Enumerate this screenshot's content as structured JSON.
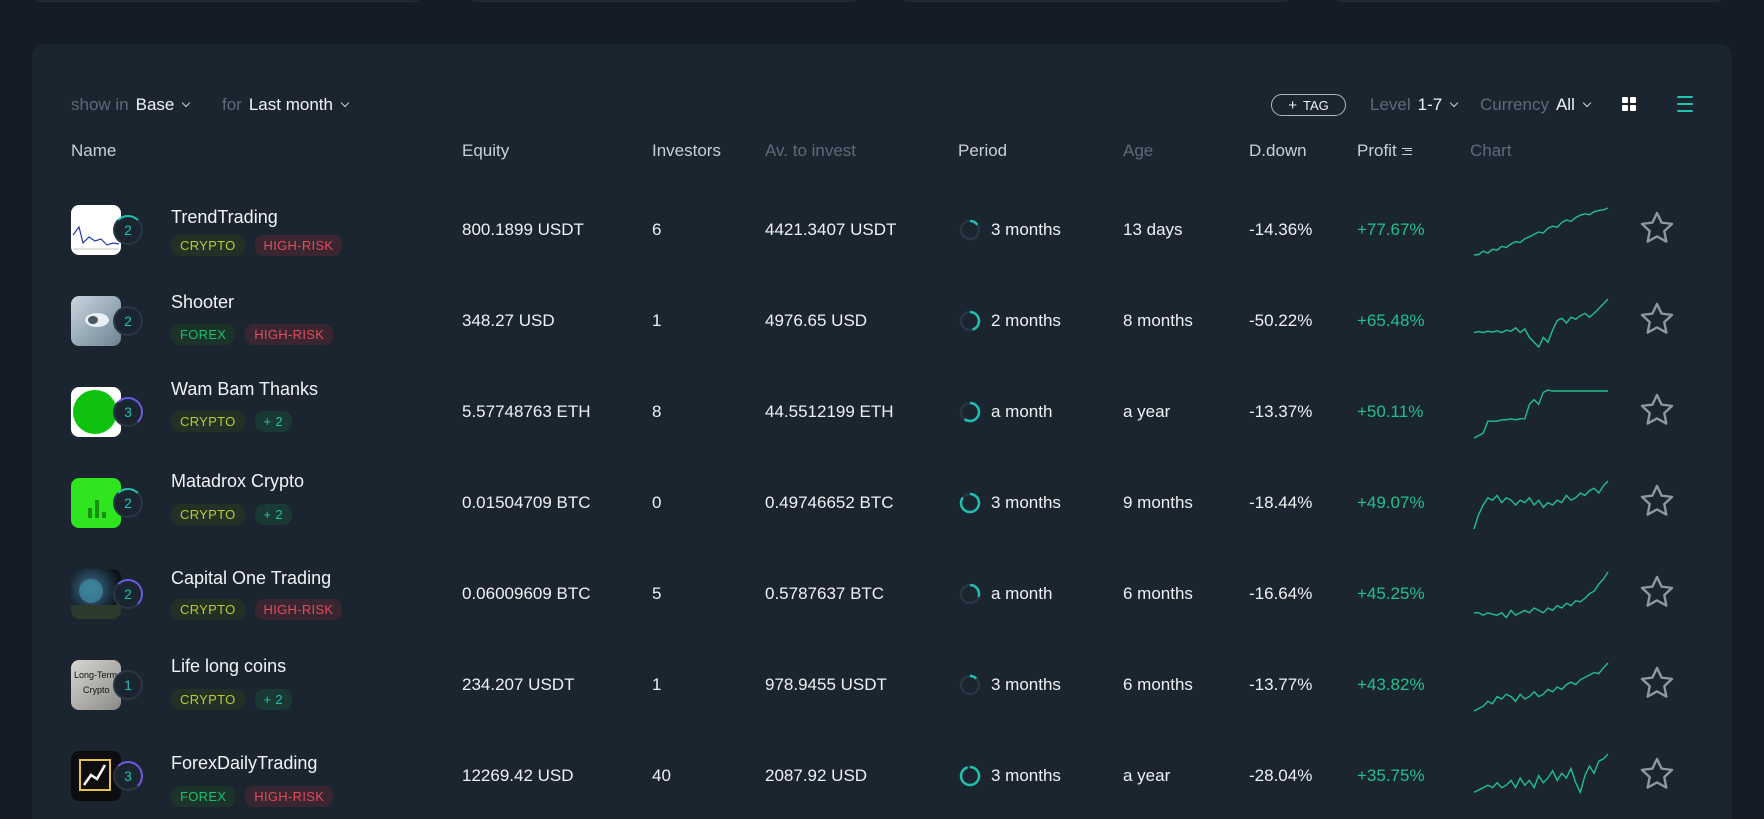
{
  "filters": {
    "show_in_label": "show in",
    "show_in_value": "Base",
    "for_label": "for",
    "for_value": "Last month",
    "tag_button": "TAG",
    "level_label": "Level",
    "level_value": "1-7",
    "currency_label": "Currency",
    "currency_value": "All"
  },
  "columns": {
    "name": "Name",
    "equity": "Equity",
    "investors": "Investors",
    "av_to_invest": "Av. to invest",
    "period": "Period",
    "age": "Age",
    "drawdown": "D.down",
    "profit": "Profit",
    "chart": "Chart"
  },
  "colors": {
    "background": "#141d26",
    "panel": "#1b2530",
    "accent": "#20c0b1",
    "profit": "#22c08e",
    "risk": "#e24b5b",
    "crypto": "#b9cc2f"
  },
  "rows": [
    {
      "name": "TrendTrading",
      "level": "2",
      "tags": [
        "CRYPTO",
        "HIGH-RISK"
      ],
      "equity": "800.1899 USDT",
      "investors": "6",
      "available": "4421.3407 USDT",
      "period": "3 months",
      "period_progress": 0.15,
      "age": "13 days",
      "drawdown": "-14.36%",
      "profit": "+77.67%",
      "avatar_icon": "trend-chart-avatar"
    },
    {
      "name": "Shooter",
      "level": "2",
      "tags": [
        "FOREX",
        "HIGH-RISK"
      ],
      "equity": "348.27 USD",
      "investors": "1",
      "available": "4976.65 USD",
      "period": "2 months",
      "period_progress": 0.45,
      "age": "8 months",
      "drawdown": "-50.22%",
      "profit": "+65.48%",
      "avatar_icon": "shooter-avatar"
    },
    {
      "name": "Wam Bam Thanks",
      "level": "3",
      "tags": [
        "CRYPTO",
        "+ 2"
      ],
      "equity": "5.57748763 ETH",
      "investors": "8",
      "available": "44.5512199 ETH",
      "period": "a month",
      "period_progress": 0.6,
      "age": "a year",
      "drawdown": "-13.37%",
      "profit": "+50.11%",
      "avatar_icon": "green-circle-avatar"
    },
    {
      "name": "Matadrox Crypto",
      "level": "2",
      "tags": [
        "CRYPTO",
        "+ 2"
      ],
      "equity": "0.01504709 BTC",
      "investors": "0",
      "available": "0.49746652 BTC",
      "period": "3 months",
      "period_progress": 0.85,
      "age": "9 months",
      "drawdown": "-18.44%",
      "profit": "+49.07%",
      "avatar_icon": "bars-avatar"
    },
    {
      "name": "Capital One Trading",
      "level": "2",
      "tags": [
        "CRYPTO",
        "HIGH-RISK"
      ],
      "equity": "0.06009609 BTC",
      "investors": "5",
      "available": "0.5787637 BTC",
      "period": "a month",
      "period_progress": 0.3,
      "age": "6 months",
      "drawdown": "-16.64%",
      "profit": "+45.25%",
      "avatar_icon": "planet-avatar"
    },
    {
      "name": "Life long coins",
      "level": "1",
      "tags": [
        "CRYPTO",
        "+ 2"
      ],
      "equity": "234.207 USDT",
      "investors": "1",
      "available": "978.9455 USDT",
      "period": "3 months",
      "period_progress": 0.12,
      "age": "6 months",
      "drawdown": "-13.77%",
      "profit": "+43.82%",
      "avatar_icon": "long-term-crypto-avatar"
    },
    {
      "name": "ForexDailyTrading",
      "level": "3",
      "tags": [
        "FOREX",
        "HIGH-RISK"
      ],
      "equity": "12269.42 USD",
      "investors": "40",
      "available": "2087.92 USD",
      "period": "3 months",
      "period_progress": 0.95,
      "age": "a year",
      "drawdown": "-28.04%",
      "profit": "+35.75%",
      "avatar_icon": "forex-logo-avatar"
    }
  ]
}
